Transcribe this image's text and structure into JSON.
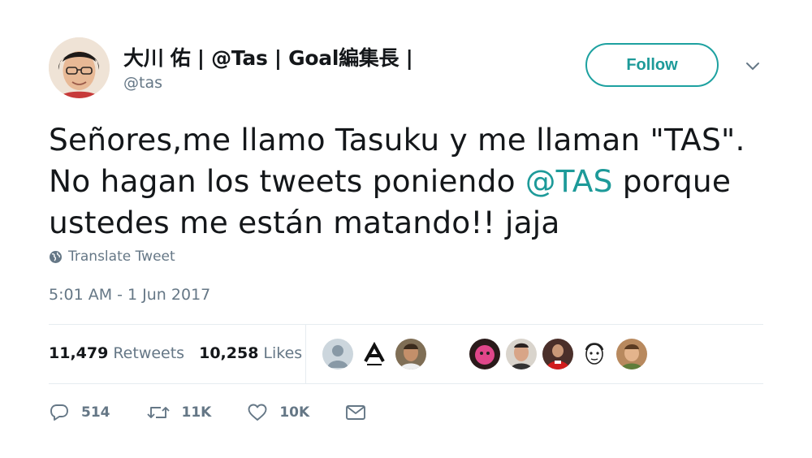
{
  "author": {
    "display_name": "大川 佑 | @Tas | Goal編集長 |",
    "handle": "@tas",
    "avatar": "avatar-photo"
  },
  "follow_button": {
    "label": "Follow"
  },
  "menu_icon": "chevron-down-icon",
  "tweet": {
    "line1": "Señores,me llamo Tasuku y me llaman \"TAS\".",
    "line2_before": "No hagan los tweets poniendo ",
    "mention": "@TAS",
    "line2_after": " porque",
    "line3": "ustedes me están matando!! jaja"
  },
  "translate": {
    "icon": "globe-icon",
    "label": "Translate Tweet"
  },
  "timestamp": "5:01 AM - 1 Jun 2017",
  "stats": {
    "retweets_count": "11,479",
    "retweets_label": "Retweets",
    "likes_count": "10,258",
    "likes_label": "Likes"
  },
  "actions": {
    "reply_count": "514",
    "retweet_count": "11K",
    "like_count": "10K"
  },
  "colors": {
    "accent": "#1d9a99",
    "muted": "#657786",
    "divider": "#e6ecf0"
  }
}
